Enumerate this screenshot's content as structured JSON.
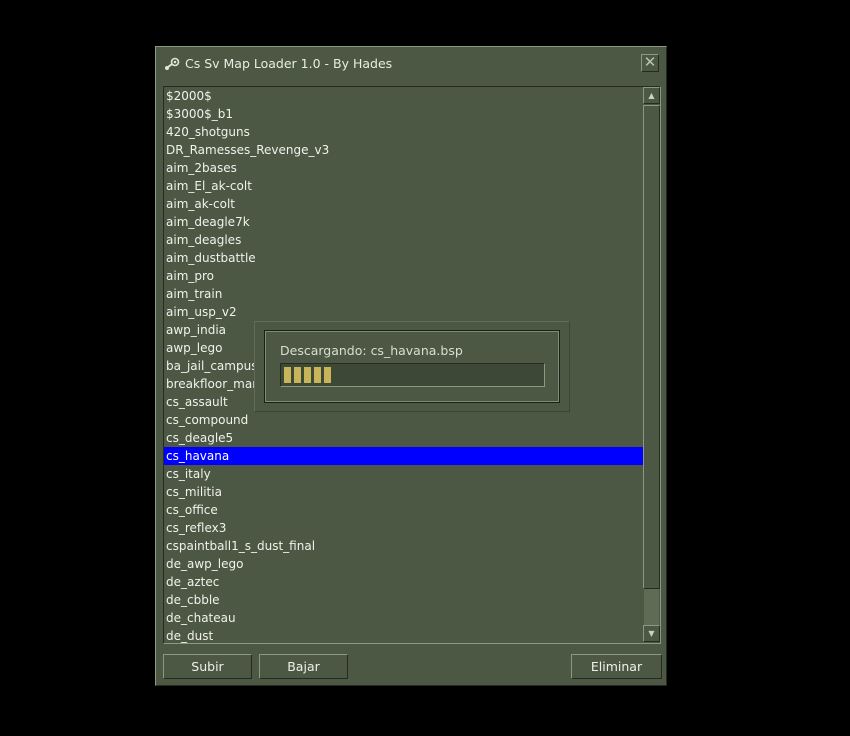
{
  "window": {
    "title": "Cs Sv Map Loader 1.0 - By Hades",
    "icon": "steam-icon",
    "close_glyph": "✕"
  },
  "maps": [
    "$2000$",
    "$3000$_b1",
    "420_shotguns",
    "DR_Ramesses_Revenge_v3",
    "aim_2bases",
    "aim_El_ak-colt",
    "aim_ak-colt",
    "aim_deagle7k",
    "aim_deagles",
    "aim_dustbattle",
    "aim_pro",
    "aim_train",
    "aim_usp_v2",
    "awp_india",
    "awp_lego",
    "ba_jail_campus",
    "breakfloor_mar",
    "cs_assault",
    "cs_compound",
    "cs_deagle5",
    "cs_havana",
    "cs_italy",
    "cs_militia",
    "cs_office",
    "cs_reflex3",
    "cspaintball1_s_dust_final",
    "de_awp_lego",
    "de_aztec",
    "de_cbble",
    "de_chateau",
    "de_dust"
  ],
  "selected_map": "cs_havana",
  "scrollbar": {
    "up_glyph": "▲",
    "down_glyph": "▼"
  },
  "buttons": {
    "up": "Subir",
    "down": "Bajar",
    "delete": "Eliminar"
  },
  "download": {
    "text": "Descargando: cs_havana.bsp",
    "progress": 0.2,
    "bar_color": "#c8b55a"
  },
  "colors": {
    "window_bg": "#4c5844",
    "selection": "#0000ff",
    "desktop": "#000000"
  }
}
